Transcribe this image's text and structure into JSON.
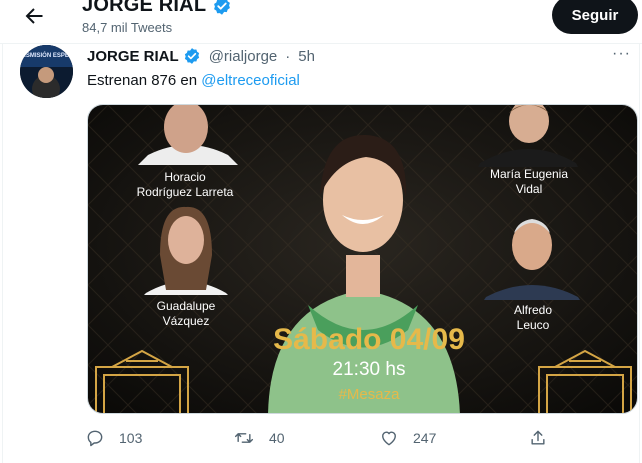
{
  "header": {
    "title": "JORGE RIAL",
    "tweet_count": "84,7 mil Tweets",
    "follow_label": "Seguir"
  },
  "tweet": {
    "display_name": "JORGE RIAL",
    "handle": "@rialjorge",
    "separator": "·",
    "time": "5h",
    "text_prefix": "Estrenan 876 en ",
    "mention": "@eltreceoficial",
    "more_label": "···",
    "avatar_caption": "TRANSMISIÓN ESPECIAL"
  },
  "media": {
    "guests": [
      {
        "name_line1": "Horacio",
        "name_line2": "Rodríguez Larreta"
      },
      {
        "name_line1": "María Eugenia",
        "name_line2": "Vidal"
      },
      {
        "name_line1": "Guadalupe",
        "name_line2": "Vázquez"
      },
      {
        "name_line1": "Alfredo",
        "name_line2": "Leuco"
      }
    ],
    "date": "Sábado 04/09",
    "time": "21:30 hs",
    "hashtag": "#Mesaza"
  },
  "actions": {
    "replies": "103",
    "retweets": "40",
    "likes": "247"
  },
  "colors": {
    "accent": "#1d9bf0",
    "gold": "#e6b94a",
    "text_secondary": "#536471"
  }
}
